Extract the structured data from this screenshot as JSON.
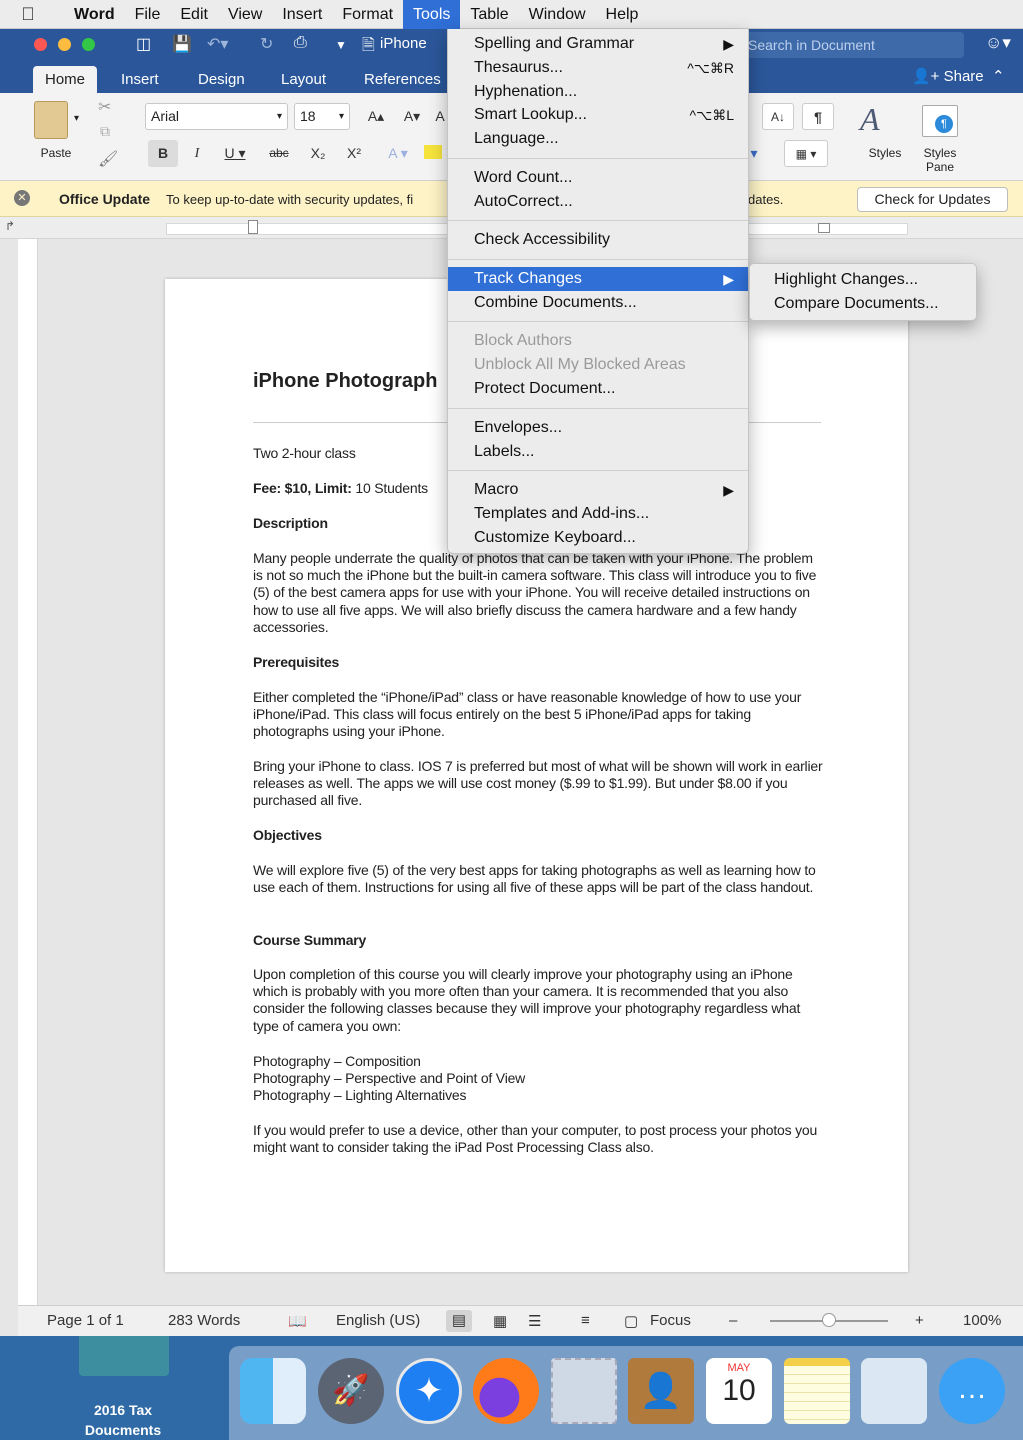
{
  "menubar": {
    "items": [
      "Word",
      "File",
      "Edit",
      "View",
      "Insert",
      "Format",
      "Tools",
      "Table",
      "Window",
      "Help"
    ]
  },
  "titlebar": {
    "doc_title": "iPhone",
    "search_placeholder": "Search in Document"
  },
  "ribbon": {
    "tabs": [
      "Home",
      "Insert",
      "Design",
      "Layout",
      "References"
    ],
    "share_label": "Share",
    "font_name": "Arial",
    "font_size": "18",
    "paste_label": "Paste",
    "styles_label": "Styles",
    "styles_pane_label": "Styles Pane"
  },
  "update_bar": {
    "title": "Office Update",
    "text": "To keep up-to-date with security updates, fi",
    "text_tail": "dates.",
    "button": "Check for Updates"
  },
  "document": {
    "title": "iPhone Photograph",
    "p1": "Two 2-hour class",
    "fee_bold": "Fee: $10, Limit:",
    "fee_rest": " 10 Students",
    "h_description": "Description",
    "p_description": "Many people underrate the quality of photos that can be taken with your iPhone.  The problem is not so much the iPhone but the built-in camera software.  This class will introduce you to five (5) of the best camera apps for use with your iPhone.  You will receive detailed instructions on how to use all five apps.  We will also briefly discuss the camera hardware and a few handy accessories.",
    "h_prereq": "Prerequisites",
    "p_prereq1": "Either completed the “iPhone/iPad” class or have reasonable knowledge of how to use your iPhone/iPad.  This class will focus entirely on the best 5 iPhone/iPad apps for taking photographs using your iPhone.",
    "p_prereq2": "Bring your iPhone to class.  IOS 7 is preferred but most of what will be shown will work in earlier releases as well.  The apps we will use cost money ($.99 to $1.99).  But under $8.00 if you purchased all five.",
    "h_objectives": "Objectives",
    "p_objectives": "We will explore five (5) of the very best apps for taking photographs as well as learning how to use each of them.  Instructions for using all five of these apps will be part of the class handout.",
    "h_summary": "Course Summary",
    "p_summary": "Upon completion of this course you will clearly improve your photography using an iPhone which is probably with you more often than your camera. It is recommended that you also consider the following classes because they will improve your photography regardless what type of camera you own:",
    "classes": [
      "Photography – Composition",
      "Photography – Perspective and Point of View",
      "Photography – Lighting Alternatives"
    ],
    "p_last": "If you would prefer to use a device, other than your computer, to post process your photos you might want to consider taking the iPad Post Processing Class also."
  },
  "statusbar": {
    "page": "Page 1 of 1",
    "words": "283 Words",
    "language": "English (US)",
    "focus": "Focus",
    "zoom": "100%",
    "zoom_level": 0.5
  },
  "desktop": {
    "folder_label": "2016 Tax Doucments",
    "calendar_month": "MAY",
    "calendar_day": "10"
  },
  "tools_menu": {
    "items": [
      {
        "label": "Spelling and Grammar",
        "shortcut": "▶"
      },
      {
        "label": "Thesaurus...",
        "shortcut": "^⌥⌘R"
      },
      {
        "label": "Hyphenation...",
        "shortcut": ""
      },
      {
        "label": "Smart Lookup...",
        "shortcut": "^⌥⌘L"
      },
      {
        "label": "Language...",
        "shortcut": ""
      },
      {
        "label": "Word Count...",
        "shortcut": ""
      },
      {
        "label": "AutoCorrect...",
        "shortcut": ""
      },
      {
        "label": "Check Accessibility",
        "shortcut": ""
      },
      {
        "label": "Track Changes",
        "shortcut": "▶"
      },
      {
        "label": "Combine Documents...",
        "shortcut": ""
      },
      {
        "label": "Block Authors",
        "shortcut": ""
      },
      {
        "label": "Unblock All My Blocked Areas",
        "shortcut": ""
      },
      {
        "label": "Protect Document...",
        "shortcut": ""
      },
      {
        "label": "Envelopes...",
        "shortcut": ""
      },
      {
        "label": "Labels...",
        "shortcut": ""
      },
      {
        "label": "Macro",
        "shortcut": "▶"
      },
      {
        "label": "Templates and Add-ins...",
        "shortcut": ""
      },
      {
        "label": "Customize Keyboard...",
        "shortcut": ""
      }
    ]
  },
  "track_submenu": {
    "items": [
      "Highlight Changes...",
      "Compare Documents..."
    ]
  },
  "colors": {
    "ribbon_blue": "#2b579a",
    "menu_highlight": "#2f6fd6"
  }
}
